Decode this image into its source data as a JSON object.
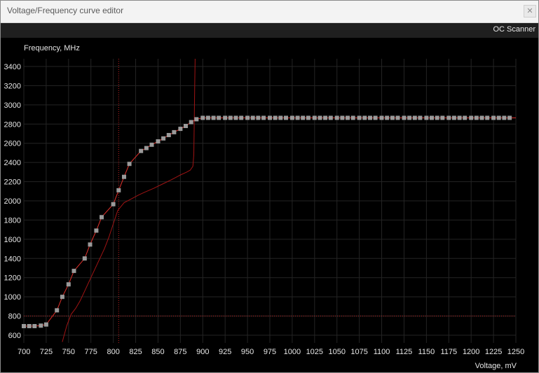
{
  "window": {
    "title": "Voltage/Frequency curve editor",
    "close_glyph": "✕"
  },
  "toolbar": {
    "oc_scanner_label": "OC Scanner"
  },
  "chart_data": {
    "type": "line",
    "ylabel": "Frequency, MHz",
    "xlabel": "Voltage, mV",
    "xlim": [
      700,
      1250
    ],
    "ylim": [
      520,
      3480
    ],
    "x_ticks": [
      700,
      725,
      750,
      775,
      800,
      825,
      850,
      875,
      900,
      925,
      950,
      975,
      1000,
      1025,
      1050,
      1075,
      1100,
      1125,
      1150,
      1175,
      1200,
      1225,
      1250
    ],
    "y_ticks": [
      600,
      800,
      1000,
      1200,
      1400,
      1600,
      1800,
      2000,
      2200,
      2400,
      2600,
      2800,
      3000,
      3200,
      3400
    ],
    "grid": true,
    "crosshair": {
      "x": 806,
      "y": 800
    },
    "colors": {
      "curve": "#e0302a",
      "points": "#9a9a9a",
      "background_curve": "#a01414",
      "crosshair": "#c02020",
      "grid": "#242424",
      "axis_text": "#e6e6e6"
    },
    "series": [
      {
        "values": [
          [
            700,
            695
          ],
          [
            706,
            695
          ],
          [
            712,
            695
          ],
          [
            719,
            700
          ],
          [
            725,
            712
          ],
          [
            737,
            860
          ],
          [
            743,
            1000
          ],
          [
            750,
            1130
          ],
          [
            756,
            1270
          ],
          [
            768,
            1400
          ],
          [
            774,
            1545
          ],
          [
            781,
            1690
          ],
          [
            787,
            1830
          ],
          [
            800,
            1965
          ],
          [
            806,
            2110
          ],
          [
            812,
            2250
          ],
          [
            818,
            2385
          ],
          [
            831,
            2520
          ],
          [
            837,
            2550
          ],
          [
            843,
            2585
          ],
          [
            850,
            2620
          ],
          [
            856,
            2650
          ],
          [
            862,
            2685
          ],
          [
            868,
            2715
          ],
          [
            875,
            2750
          ],
          [
            881,
            2780
          ],
          [
            887,
            2820
          ],
          [
            893,
            2850
          ],
          [
            900,
            2865
          ],
          [
            906,
            2865
          ],
          [
            912,
            2865
          ],
          [
            918,
            2865
          ],
          [
            925,
            2865
          ],
          [
            931,
            2865
          ],
          [
            937,
            2865
          ],
          [
            943,
            2865
          ],
          [
            950,
            2865
          ],
          [
            956,
            2865
          ],
          [
            962,
            2865
          ],
          [
            968,
            2865
          ],
          [
            975,
            2865
          ],
          [
            981,
            2865
          ],
          [
            987,
            2865
          ],
          [
            993,
            2865
          ],
          [
            1000,
            2865
          ],
          [
            1006,
            2865
          ],
          [
            1012,
            2865
          ],
          [
            1018,
            2865
          ],
          [
            1025,
            2865
          ],
          [
            1031,
            2865
          ],
          [
            1037,
            2865
          ],
          [
            1043,
            2865
          ],
          [
            1050,
            2865
          ],
          [
            1056,
            2865
          ],
          [
            1062,
            2865
          ],
          [
            1068,
            2865
          ],
          [
            1075,
            2865
          ],
          [
            1081,
            2865
          ],
          [
            1087,
            2865
          ],
          [
            1093,
            2865
          ],
          [
            1100,
            2865
          ],
          [
            1106,
            2865
          ],
          [
            1112,
            2865
          ],
          [
            1118,
            2865
          ],
          [
            1125,
            2865
          ],
          [
            1131,
            2865
          ],
          [
            1137,
            2865
          ],
          [
            1143,
            2865
          ],
          [
            1150,
            2865
          ],
          [
            1156,
            2865
          ],
          [
            1162,
            2865
          ],
          [
            1168,
            2865
          ],
          [
            1175,
            2865
          ],
          [
            1181,
            2865
          ],
          [
            1187,
            2865
          ],
          [
            1193,
            2865
          ],
          [
            1200,
            2865
          ],
          [
            1206,
            2865
          ],
          [
            1212,
            2865
          ],
          [
            1218,
            2865
          ],
          [
            1225,
            2865
          ],
          [
            1231,
            2865
          ],
          [
            1237,
            2865
          ],
          [
            1243,
            2865
          ],
          [
            1250,
            2865
          ]
        ]
      }
    ],
    "background_curve": [
      [
        743,
        530
      ],
      [
        748,
        700
      ],
      [
        753,
        820
      ],
      [
        758,
        880
      ],
      [
        763,
        960
      ],
      [
        768,
        1060
      ],
      [
        775,
        1200
      ],
      [
        783,
        1360
      ],
      [
        790,
        1500
      ],
      [
        795,
        1620
      ],
      [
        800,
        1760
      ],
      [
        805,
        1900
      ],
      [
        812,
        1980
      ],
      [
        820,
        2020
      ],
      [
        828,
        2060
      ],
      [
        835,
        2090
      ],
      [
        845,
        2130
      ],
      [
        855,
        2175
      ],
      [
        865,
        2220
      ],
      [
        875,
        2270
      ],
      [
        882,
        2300
      ],
      [
        886,
        2320
      ],
      [
        889,
        2360
      ],
      [
        890,
        2480
      ],
      [
        890.5,
        2800
      ],
      [
        891,
        3200
      ],
      [
        891.5,
        3480
      ]
    ]
  }
}
